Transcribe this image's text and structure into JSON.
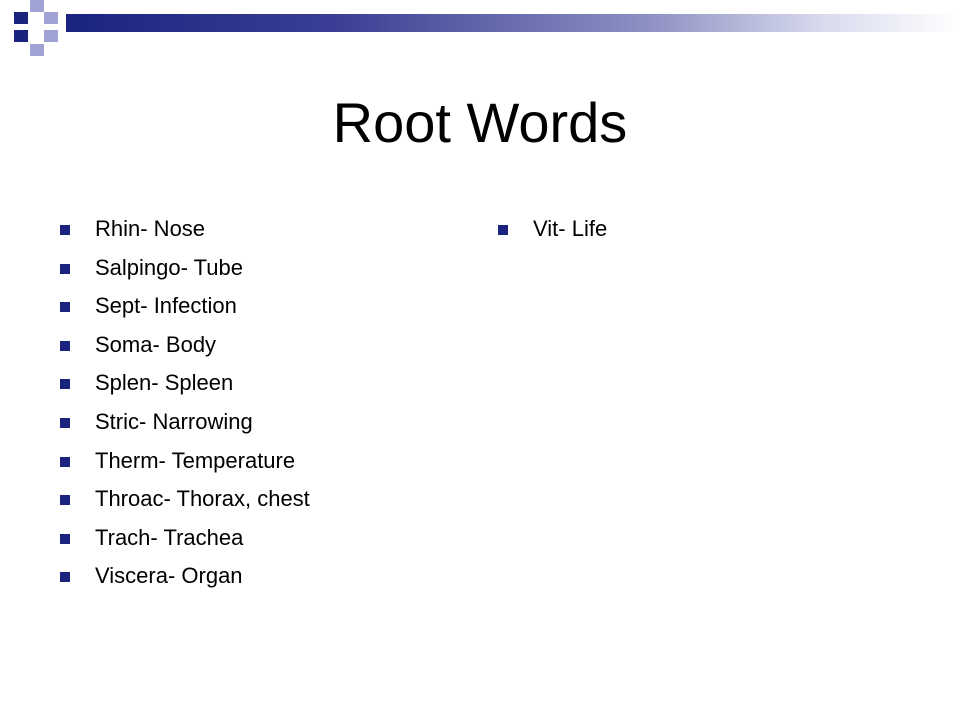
{
  "slide": {
    "title": "Root Words",
    "left_items": [
      "Rhin- Nose",
      "Salpingo- Tube",
      "Sept- Infection",
      "Soma- Body",
      "Splen- Spleen",
      "Stric- Narrowing",
      "Therm- Temperature",
      "Throac- Thorax, chest",
      "Trach- Trachea",
      "Viscera- Organ"
    ],
    "right_items": [
      "Vit- Life"
    ]
  },
  "colors": {
    "accent": "#1a237e",
    "accent_light": "#9fa3d4",
    "background": "#ffffff",
    "text": "#000000"
  }
}
